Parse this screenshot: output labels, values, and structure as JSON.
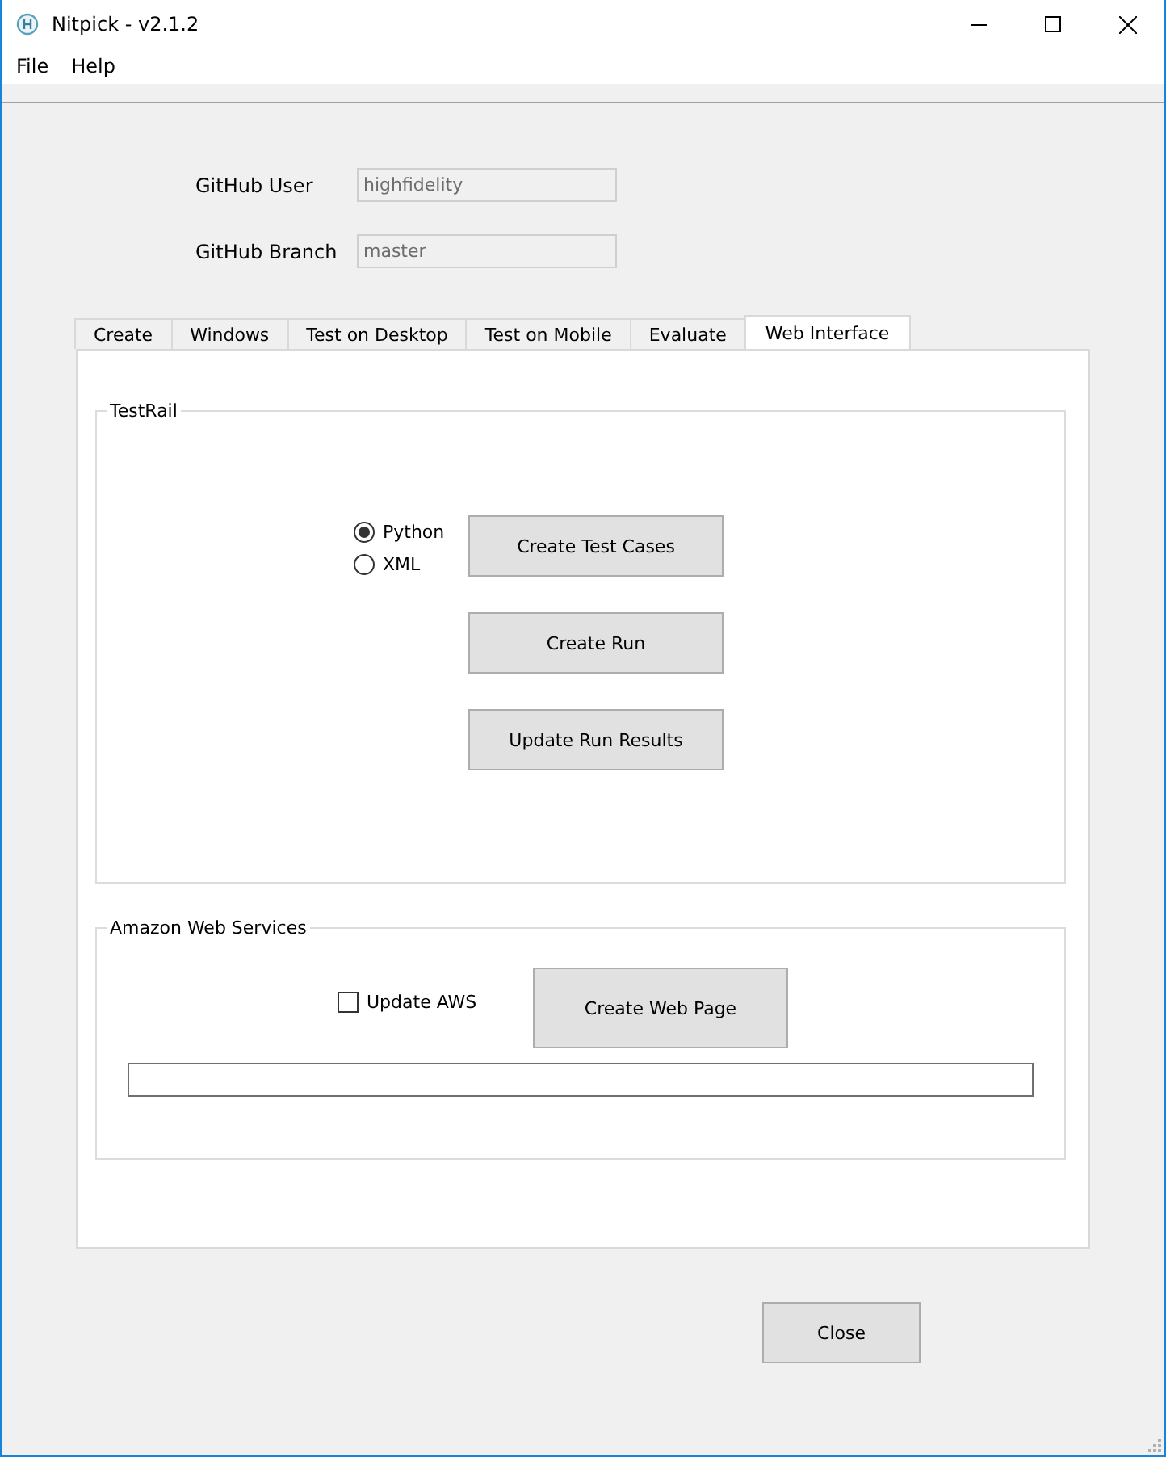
{
  "window": {
    "title": "Nitpick - v2.1.2"
  },
  "menu": [
    "File",
    "Help"
  ],
  "fields": [
    {
      "label": "GitHub User",
      "value": "highfidelity",
      "disabled": true
    },
    {
      "label": "GitHub Branch",
      "value": "master",
      "disabled": true
    }
  ],
  "tabs": [
    {
      "label": "Create",
      "selected": false
    },
    {
      "label": "Windows",
      "selected": false
    },
    {
      "label": "Test on Desktop",
      "selected": false
    },
    {
      "label": "Test on Mobile",
      "selected": false
    },
    {
      "label": "Evaluate",
      "selected": false
    },
    {
      "label": "Web Interface",
      "selected": true
    }
  ],
  "testrail": {
    "title": "TestRail",
    "radios": [
      {
        "label": "Python",
        "selected": true
      },
      {
        "label": "XML",
        "selected": false
      }
    ],
    "buttons": [
      "Create Test Cases",
      "Create Run",
      "Update Run Results"
    ]
  },
  "aws": {
    "title": "Amazon Web Services",
    "checkbox": {
      "label": "Update AWS",
      "checked": false
    },
    "button": "Create Web Page"
  },
  "close_button": "Close"
}
